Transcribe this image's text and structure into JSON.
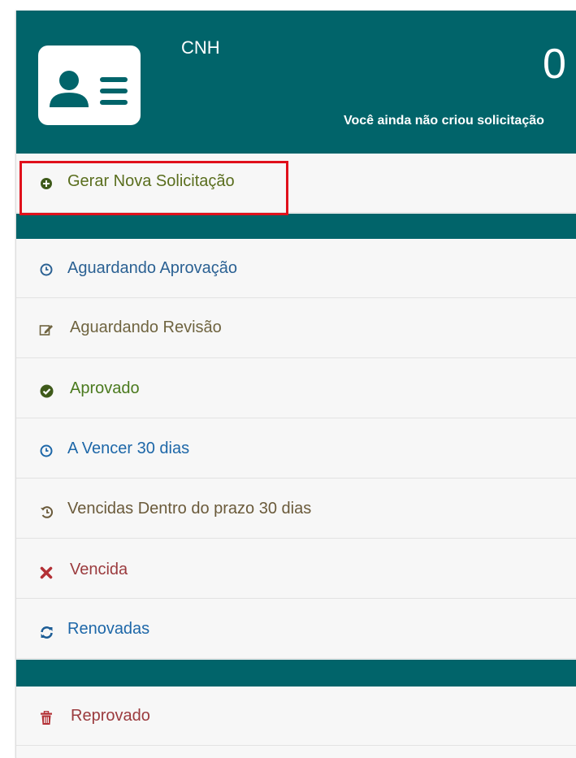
{
  "header": {
    "title": "CNH",
    "count": "0",
    "subtitle": "Você ainda não criou solicitação",
    "icon": "id-card-icon",
    "background_color": "#01646a"
  },
  "menu": {
    "create": {
      "label": "Gerar Nova Solicitação",
      "icon": "plus-circle-icon",
      "color": "#5a6e1e"
    },
    "statuses": [
      {
        "label": "Aguardando Aprovação",
        "icon": "clock-icon",
        "color": "#2b6193"
      },
      {
        "label": "Aguardando Revisão",
        "icon": "edit-icon",
        "color": "#6f6440"
      },
      {
        "label": "Aprovado",
        "icon": "check-circle-icon",
        "color": "#4a7a1e"
      },
      {
        "label": "A Vencer 30 dias",
        "icon": "clock-icon",
        "color": "#1d67a8"
      },
      {
        "label": "Vencidas Dentro do prazo 30 dias",
        "icon": "history-icon",
        "color": "#6a5a3a"
      },
      {
        "label": "Vencida",
        "icon": "close-icon",
        "color": "#9b3b3e"
      },
      {
        "label": "Renovadas",
        "icon": "refresh-icon",
        "color": "#1d67a8"
      }
    ],
    "rejected": {
      "label": "Reprovado",
      "icon": "trash-icon",
      "color": "#9b3b3e"
    }
  },
  "highlight_color": "#e0101b"
}
